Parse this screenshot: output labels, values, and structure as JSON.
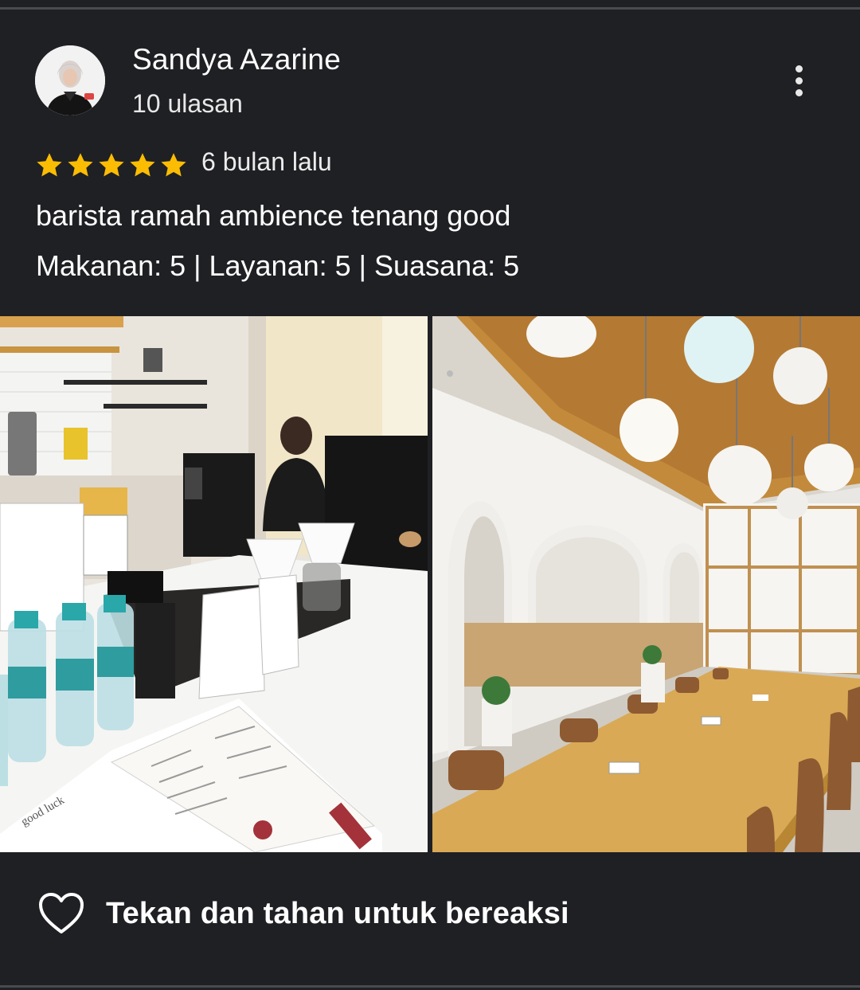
{
  "review": {
    "author_name": "Sandya Azarine",
    "review_count": "10 ulasan",
    "rating": 5,
    "max_rating": 5,
    "time_ago": "6 bulan lalu",
    "text": "barista ramah ambience tenang good",
    "sub_ratings": "Makanan: 5 | Layanan: 5 | Suasana: 5"
  },
  "photos": [
    {
      "name": "photo-coffee-bar",
      "brand_text": "good luck"
    },
    {
      "name": "photo-dining-room"
    }
  ],
  "actions": {
    "react_label": "Tekan dan tahan untuk bereaksi",
    "react_icon": "heart-outline-icon",
    "menu_icon": "more-vertical-icon"
  },
  "colors": {
    "background": "#1f2023",
    "star": "#fbbc04",
    "text": "#ffffff"
  }
}
